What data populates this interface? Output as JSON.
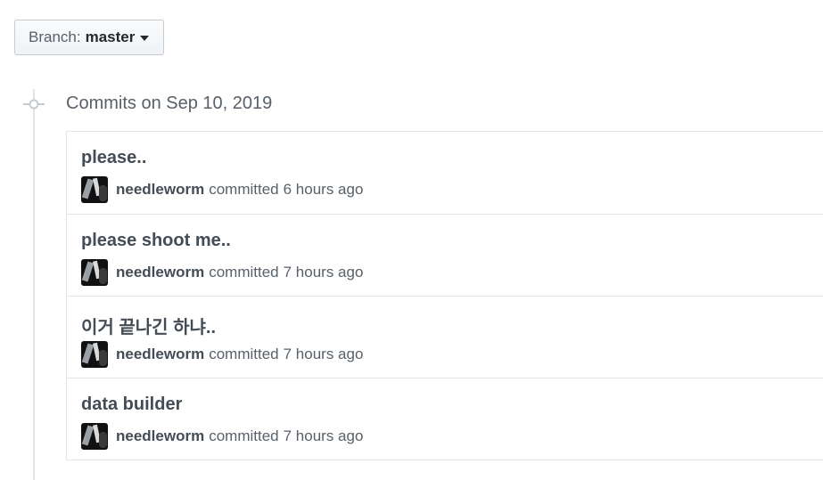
{
  "branch": {
    "prefix": "Branch:",
    "name": "master"
  },
  "timeline": {
    "date_heading": "Commits on Sep 10, 2019"
  },
  "commits": [
    {
      "title": "please..",
      "author": "needleworm",
      "action": "committed",
      "time": "6 hours ago"
    },
    {
      "title": "please shoot me..",
      "author": "needleworm",
      "action": "committed",
      "time": "7 hours ago"
    },
    {
      "title": "이거 끝나긴 하냐..",
      "author": "needleworm",
      "action": "committed",
      "time": "7 hours ago"
    },
    {
      "title": "data builder",
      "author": "needleworm",
      "action": "committed",
      "time": "7 hours ago"
    }
  ],
  "icons": {
    "branch_caret": "caret-down-icon",
    "commit_node": "git-commit-icon"
  }
}
